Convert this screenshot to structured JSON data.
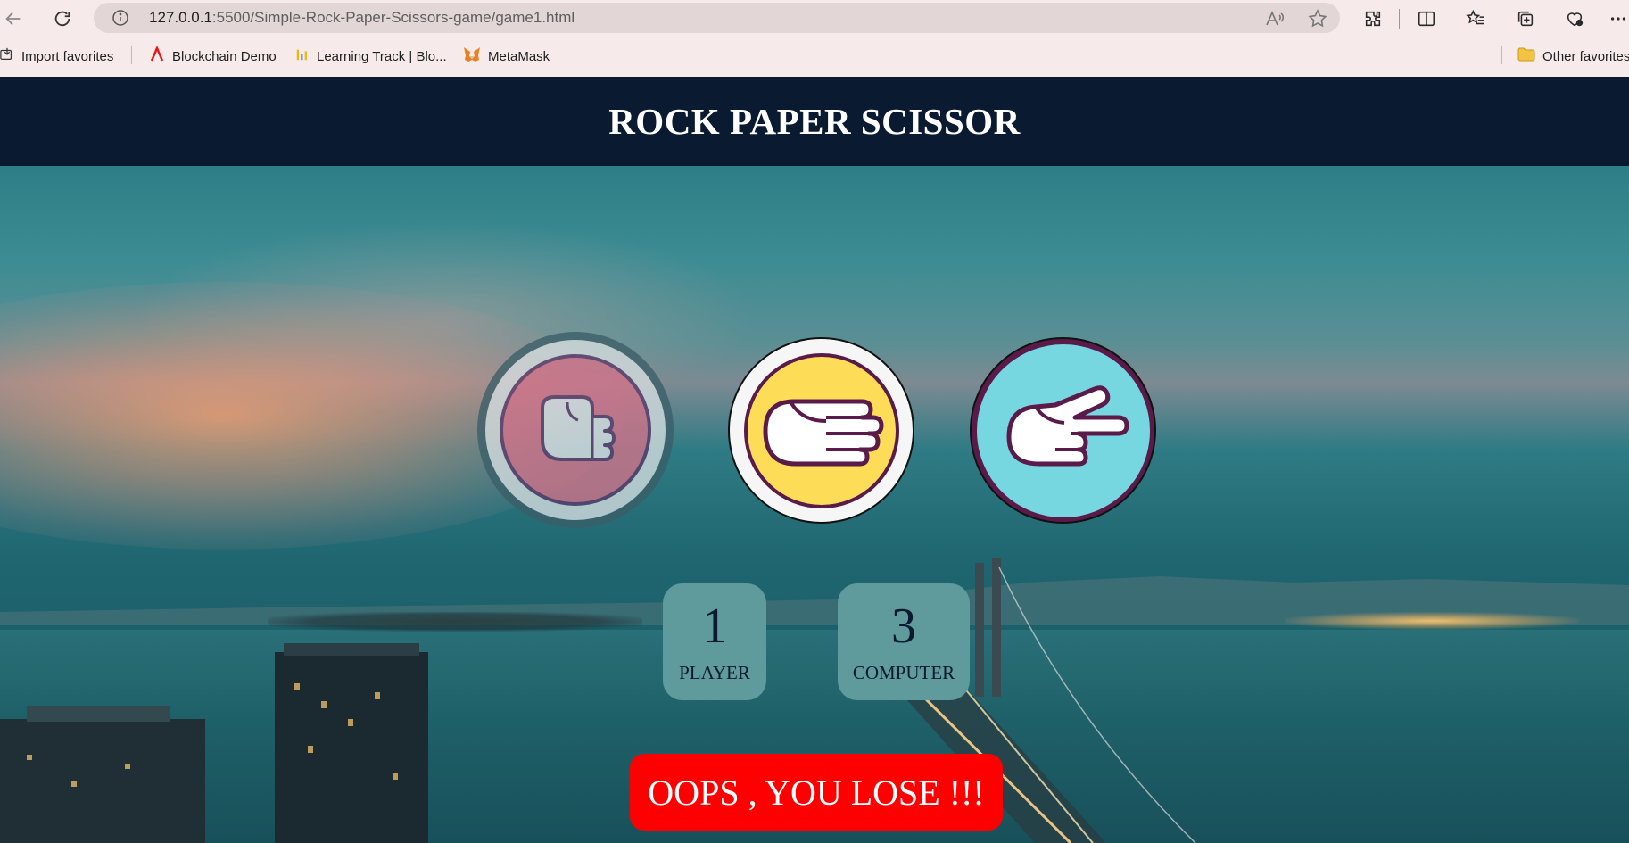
{
  "browser": {
    "url_host": "127.0.0.1",
    "url_path": ":5500/Simple-Rock-Paper-Scissors-game/game1.html",
    "bookmarks": [
      {
        "label": "Import favorites",
        "icon": "import-icon"
      },
      {
        "label": "Blockchain Demo",
        "icon": "blockchain-demo-icon"
      },
      {
        "label": "Learning Track | Blo...",
        "icon": "learning-track-icon"
      },
      {
        "label": "MetaMask",
        "icon": "metamask-fox-icon"
      }
    ],
    "other_favorites": "Other favorites"
  },
  "game": {
    "title": "ROCK PAPER SCISSOR",
    "choices": [
      {
        "name": "rock",
        "icon": "fist-rock-icon",
        "accent": "#d4738a"
      },
      {
        "name": "paper",
        "icon": "open-hand-paper-icon",
        "accent": "#fddd57"
      },
      {
        "name": "scissor",
        "icon": "two-finger-scissor-icon",
        "accent": "#76d7e0"
      }
    ],
    "scoreboard": {
      "player_score": "1",
      "player_label": "PLAYER",
      "computer_score": "3",
      "computer_label": "COMPUTER"
    },
    "result_message": "OOPS , YOU LOSE !!!",
    "colors": {
      "header_bg": "#0a1a30",
      "score_bg": "#5f9a9d",
      "lose_bg": "#ff0000"
    }
  }
}
